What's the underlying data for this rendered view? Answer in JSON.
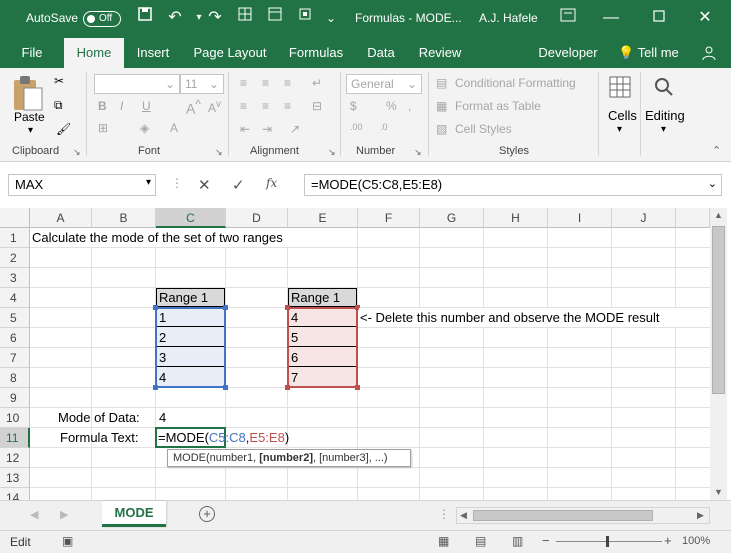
{
  "titlebar": {
    "autosave": "AutoSave",
    "autosave_state": "Off",
    "title": "Formulas - MODE...",
    "user": "A.J. Hafele"
  },
  "tabs": [
    "File",
    "Home",
    "Insert",
    "Page Layout",
    "Formulas",
    "Data",
    "Review",
    "Developer",
    "Tell me"
  ],
  "ribbon": {
    "paste": "Paste",
    "clipboard": "Clipboard",
    "font": "Font",
    "font_size": "11",
    "alignment": "Alignment",
    "number_format": "General",
    "number": "Number",
    "conditional_formatting": "Conditional Formatting",
    "format_as_table": "Format as Table",
    "cell_styles": "Cell Styles",
    "styles": "Styles",
    "cells": "Cells",
    "editing": "Editing",
    "bold": "B",
    "italic": "I",
    "underline": "U",
    "currency": "$",
    "percent": "%"
  },
  "formula_bar": {
    "name_box": "MAX",
    "fx": "fx",
    "formula": "=MODE(C5:C8,E5:E8)"
  },
  "columns": [
    "A",
    "B",
    "C",
    "D",
    "E",
    "F",
    "G",
    "H",
    "I",
    "J"
  ],
  "rows": [
    "1",
    "2",
    "3",
    "4",
    "5",
    "6",
    "7",
    "8",
    "9",
    "10",
    "11",
    "12",
    "13",
    "14"
  ],
  "cells": {
    "a1": "Calculate the mode of the set of two ranges",
    "c4": "Range 1",
    "e4": "Range 1",
    "c5": "1",
    "c6": "2",
    "c7": "3",
    "c8": "4",
    "e5": "4",
    "e6": "5",
    "e7": "6",
    "e8": "7",
    "f5": "<- Delete this number and observe the MODE result",
    "b10": "Mode of Data:",
    "c10": "4",
    "b11": "Formula Text:",
    "c11_prefix": "=MODE(",
    "c11_ref1": "C5:C8",
    "c11_comma": ",",
    "c11_ref2": "E5:E8",
    "c11_suffix": ")"
  },
  "tooltip": {
    "prefix": "MODE(number1, ",
    "bold": "[number2]",
    "suffix": ", [number3], ...)"
  },
  "sheet_tab": "MODE",
  "status": {
    "mode": "Edit",
    "zoom": "100%"
  },
  "colors": {
    "excel_green": "#217346",
    "ref_blue": "#4472c4",
    "ref_red": "#c0504d"
  }
}
